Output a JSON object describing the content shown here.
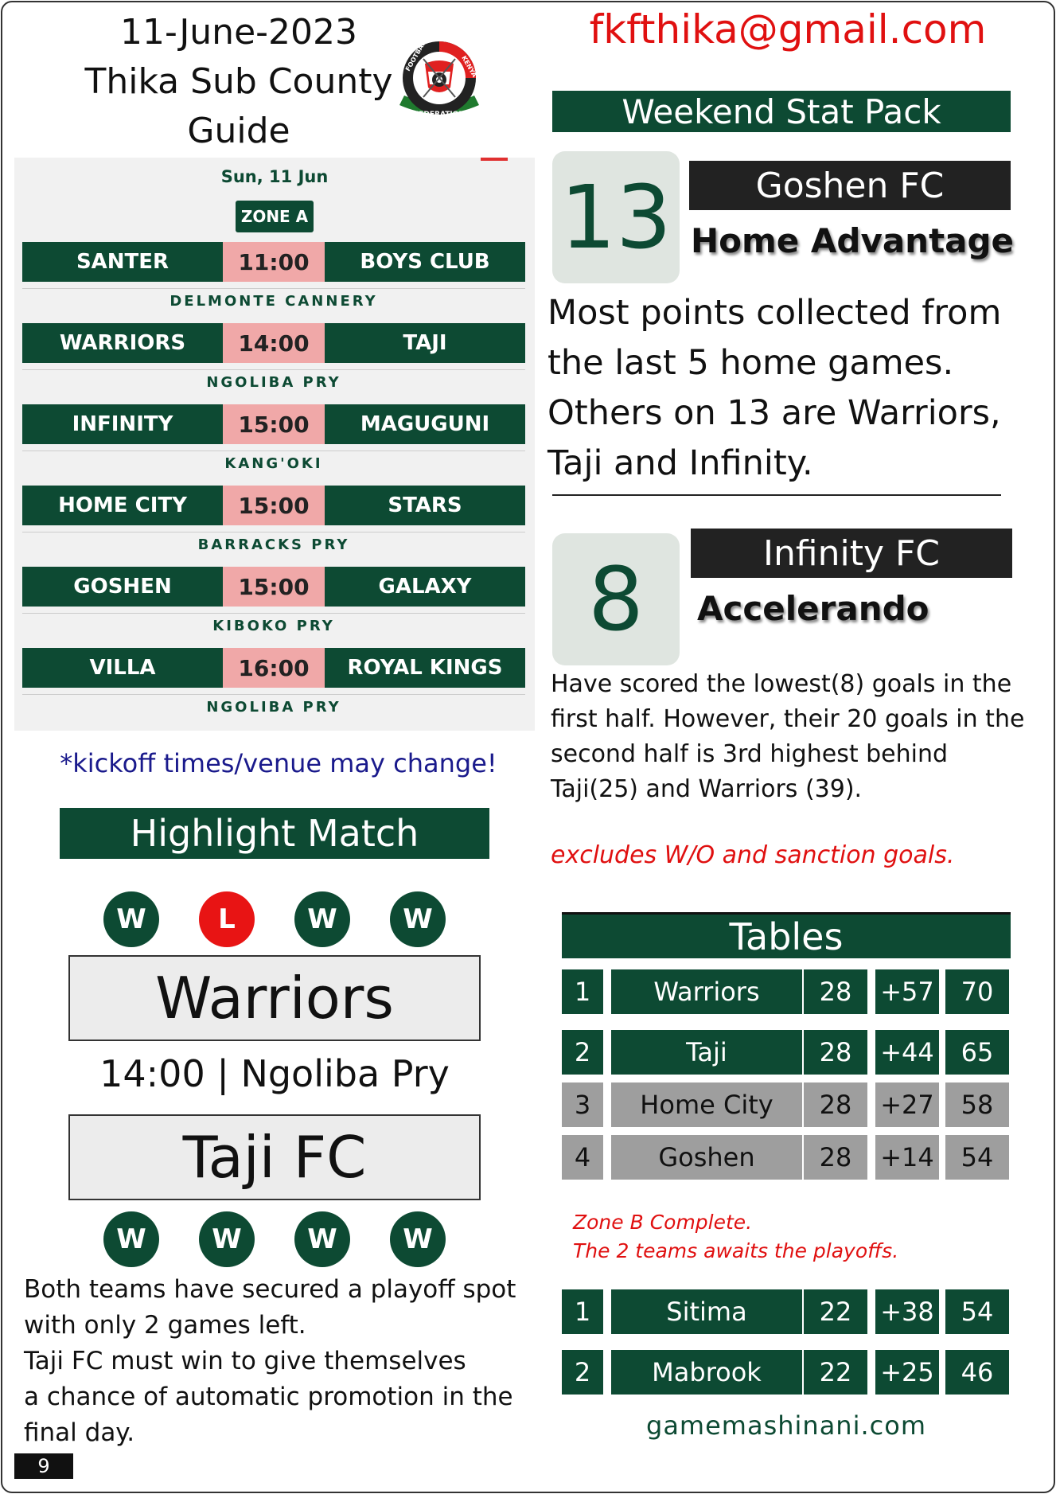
{
  "header": {
    "date": "11-June-2023",
    "title_line1": "Thika Sub County",
    "title_line2": "Guide",
    "email": "fkfthika@gmail.com",
    "crest_text_left": "FOOTBALL",
    "crest_text_right": "KENYA",
    "crest_text_bottom": "FEDERATION"
  },
  "fixtures": {
    "date_label": "Sun, 11 Jun",
    "zone_label": "ZONE A",
    "matches": [
      {
        "home": "SANTER",
        "time": "11:00",
        "away": "BOYS CLUB",
        "venue": "DELMONTE CANNERY"
      },
      {
        "home": "WARRIORS",
        "time": "14:00",
        "away": "TAJI",
        "venue": "NGOLIBA PRY"
      },
      {
        "home": "INFINITY",
        "time": "15:00",
        "away": "MAGUGUNI",
        "venue": "KANG'OKI"
      },
      {
        "home": "HOME CITY",
        "time": "15:00",
        "away": "STARS",
        "venue": "BARRACKS PRY"
      },
      {
        "home": "GOSHEN",
        "time": "15:00",
        "away": "GALAXY",
        "venue": "KIBOKO PRY"
      },
      {
        "home": "VILLA",
        "time": "16:00",
        "away": "ROYAL KINGS",
        "venue": "NGOLIBA PRY"
      }
    ],
    "disclaimer": "*kickoff times/venue may change!"
  },
  "highlight": {
    "title": "Highlight Match",
    "home_form": [
      "W",
      "L",
      "W",
      "W"
    ],
    "home_team": "Warriors",
    "info": "14:00 | Ngoliba Pry",
    "away_team": "Taji FC",
    "away_form": [
      "W",
      "W",
      "W",
      "W"
    ],
    "text": [
      "Both teams have secured a playoff spot",
      "with only 2 games left.",
      "Taji FC must win to give themselves",
      "a chance of automatic promotion in the",
      "final day."
    ]
  },
  "page_number": "9",
  "stat_pack": {
    "title": "Weekend Stat Pack",
    "stat1": {
      "number": "13",
      "team": "Goshen FC",
      "headline": "Home Advantage",
      "description": [
        "Most points collected from",
        "the last 5 home games.",
        "Others on 13 are Warriors,",
        "Taji and Infinity."
      ]
    },
    "stat2": {
      "number": "8",
      "team": "Infinity FC",
      "headline": "Accelerando",
      "description": [
        "Have scored the lowest(8) goals in the",
        "first half. However, their 20 goals in the",
        "second half is 3rd highest behind",
        "Taji(25) and Warriors (39)."
      ],
      "note": "excludes W/O and sanction goals."
    }
  },
  "tables": {
    "title": "Tables",
    "zone_a": [
      {
        "pos": "1",
        "team": "Warriors",
        "played": "28",
        "gd": "+57",
        "pts": "70",
        "style": "green"
      },
      {
        "pos": "2",
        "team": "Taji",
        "played": "28",
        "gd": "+44",
        "pts": "65",
        "style": "green"
      },
      {
        "pos": "3",
        "team": "Home City",
        "played": "28",
        "gd": "+27",
        "pts": "58",
        "style": "grey"
      },
      {
        "pos": "4",
        "team": "Goshen",
        "played": "28",
        "gd": "+14",
        "pts": "54",
        "style": "grey"
      }
    ],
    "zone_b_note_line1": "Zone B Complete.",
    "zone_b_note_line2": "The 2 teams awaits the playoffs.",
    "zone_b": [
      {
        "pos": "1",
        "team": "Sitima",
        "played": "22",
        "gd": "+38",
        "pts": "54",
        "style": "green"
      },
      {
        "pos": "2",
        "team": "Mabrook",
        "played": "22",
        "gd": "+25",
        "pts": "46",
        "style": "green"
      }
    ]
  },
  "footer": {
    "site": "gamemashinani.com"
  },
  "colors": {
    "brand_green": "#0d4a33",
    "accent_red": "#e01010",
    "loss_red": "#e81414",
    "time_pink": "#f0a8a8",
    "grey_row": "#9e9e9e"
  }
}
